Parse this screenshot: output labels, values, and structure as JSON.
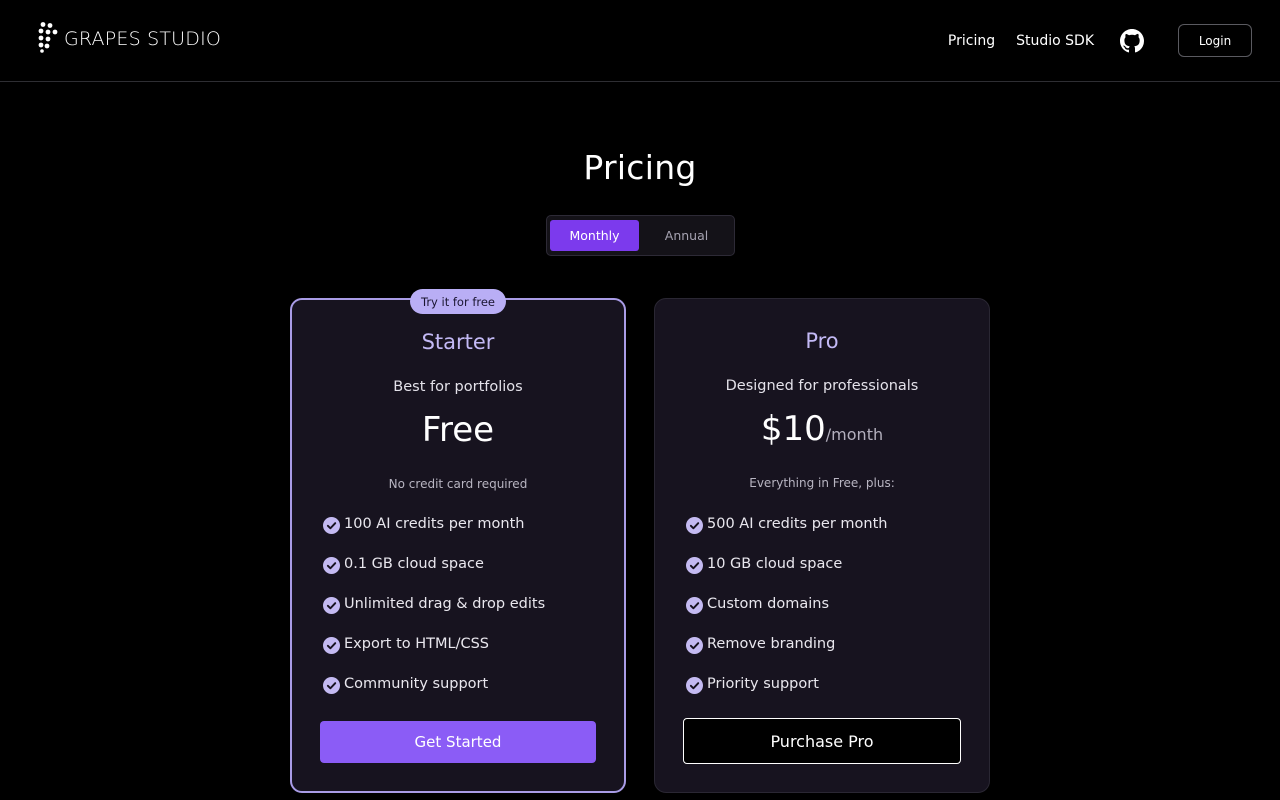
{
  "header": {
    "logo_text": "GRAPES STUDIO",
    "logo_icon": "grapes-icon",
    "nav": {
      "pricing_label": "Pricing",
      "sdk_label": "Studio SDK",
      "github_icon": "github-icon",
      "login_label": "Login"
    }
  },
  "main": {
    "title": "Pricing",
    "billing_toggle": {
      "options": [
        "Monthly",
        "Annual"
      ],
      "selected": "Monthly"
    }
  },
  "plans": [
    {
      "badge": "Try it for free",
      "name": "Starter",
      "description": "Best for portfolios",
      "price": "Free",
      "price_unit": "",
      "note": "No credit card required",
      "features": [
        "100 AI credits per month",
        "0.1 GB cloud space",
        "Unlimited drag & drop edits",
        "Export to HTML/CSS",
        "Community support"
      ],
      "cta": "Get Started"
    },
    {
      "name": "Pro",
      "description": "Designed for professionals",
      "price": "$10",
      "price_unit": "/month",
      "note": "Everything in Free, plus:",
      "features": [
        "500 AI credits per month",
        "10 GB cloud space",
        "Custom domains",
        "Remove branding",
        "Priority support"
      ],
      "cta": "Purchase Pro"
    }
  ],
  "colors": {
    "background": "#000000",
    "accent": "#7c3aed",
    "button_primary": "#8b5cf6",
    "plan_name": "#c3b9f5",
    "badge": "#b9aef5",
    "card": "#17131f",
    "check": "#c4baf2"
  }
}
